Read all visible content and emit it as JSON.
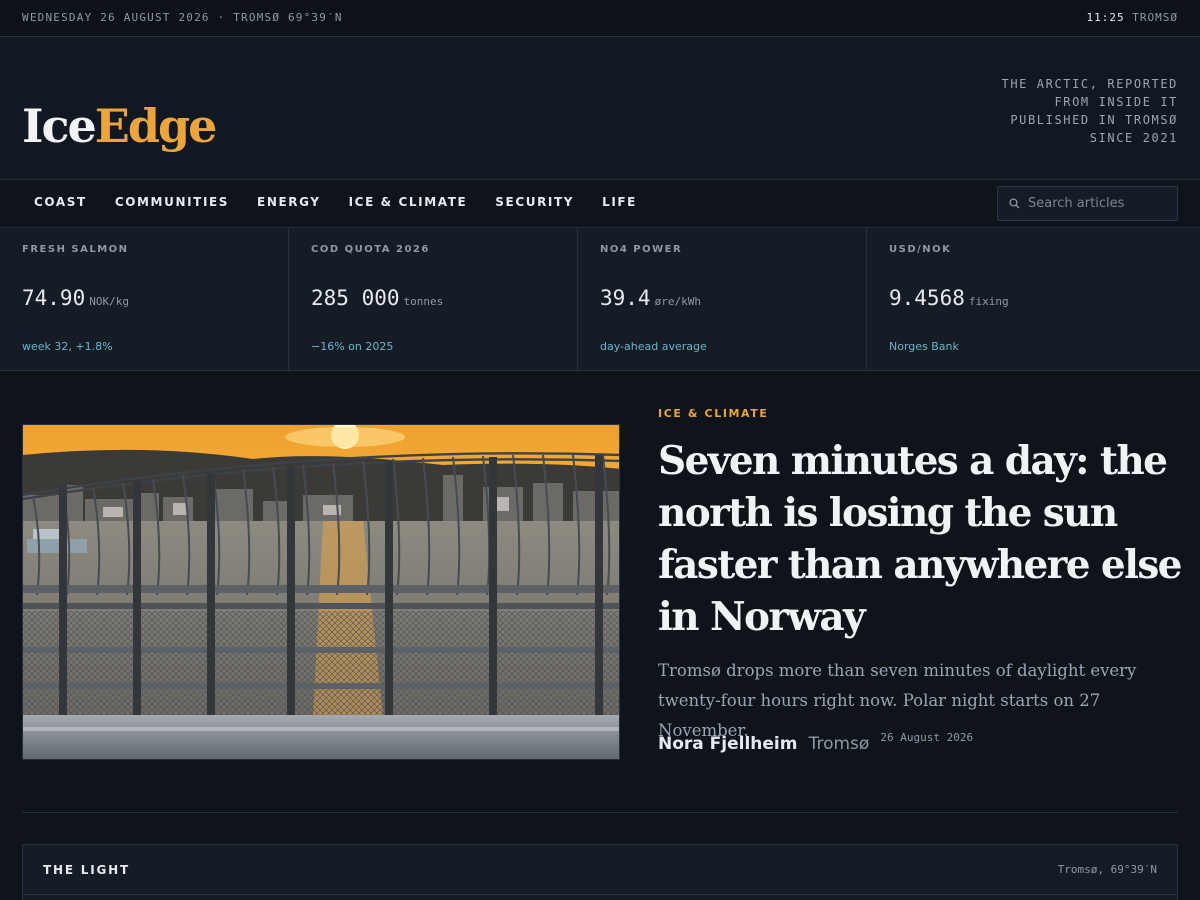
{
  "topbar": {
    "dateline": "WEDNESDAY 26 AUGUST 2026 · TROMSØ 69°39′N",
    "time": "11:25",
    "location": "TROMSØ"
  },
  "masthead": {
    "logo_part1": "Ice",
    "logo_part2": "Edge",
    "tagline": [
      "THE ARCTIC, REPORTED",
      "FROM INSIDE IT",
      "PUBLISHED IN TROMSØ",
      "SINCE 2021"
    ]
  },
  "nav": {
    "items": [
      "COAST",
      "COMMUNITIES",
      "ENERGY",
      "ICE & CLIMATE",
      "SECURITY",
      "LIFE"
    ],
    "search_placeholder": "Search articles"
  },
  "ticker": [
    {
      "label": "FRESH SALMON",
      "value": "74.90",
      "unit": "NOK/kg",
      "note": "week 32, +1.8%"
    },
    {
      "label": "COD QUOTA 2026",
      "value": "285 000",
      "unit": "tonnes",
      "note": "−16% on 2025"
    },
    {
      "label": "NO4 POWER",
      "value": "39.4",
      "unit": "øre/kWh",
      "note": "day-ahead average"
    },
    {
      "label": "USD/NOK",
      "value": "9.4568",
      "unit": "fixing",
      "note": "Norges Bank"
    }
  ],
  "hero": {
    "kicker": "ICE & CLIMATE",
    "headline": "Seven minutes a day: the north is losing the sun faster than anywhere else in Norway",
    "dek": "Tromsø drops more than seven minutes of daylight every twenty-four hours right now. Polar night starts on 27 November.",
    "author": "Nora Fjellheim",
    "place": "Tromsø",
    "date": "26 August 2026"
  },
  "panel": {
    "title": "THE LIGHT",
    "location": "Tromsø, 69°39′N"
  },
  "colors": {
    "background": "#0f141b",
    "accent": "#eba53c",
    "link": "#6ab6c9",
    "text": "#e6e9ee",
    "muted": "#8e99a8"
  }
}
